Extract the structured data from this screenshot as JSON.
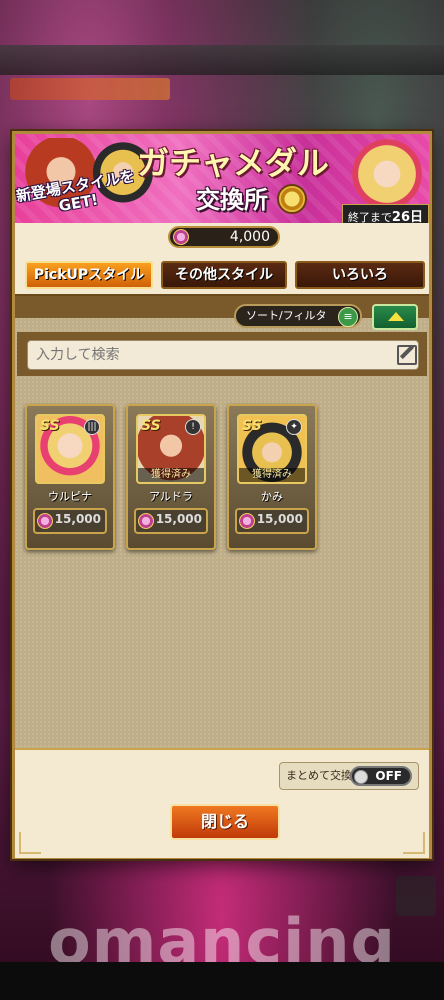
{
  "background": {
    "logo_text": "omancing"
  },
  "banner": {
    "title": "ガチャメダル",
    "subtitle": "交換所",
    "tag": "新登場スタイルをGET!",
    "end_label": "終了まで",
    "end_value": "26日"
  },
  "medal_balance": "4,000",
  "tabs": [
    {
      "label": "PickUPスタイル",
      "active": true
    },
    {
      "label": "その他スタイル",
      "active": false
    },
    {
      "label": "いろいろ",
      "active": false
    }
  ],
  "sort_label": "ソート/フィルタ",
  "search": {
    "placeholder": "入力して検索"
  },
  "items": [
    {
      "name": "ウルピナ",
      "price": "15,000",
      "owned_label": "",
      "rank": "SS"
    },
    {
      "name": "アルドラ",
      "price": "15,000",
      "owned_label": "獲得済み",
      "rank": "SS"
    },
    {
      "name": "かみ",
      "price": "15,000",
      "owned_label": "獲得済み",
      "rank": "SS"
    }
  ],
  "bulk_exchange": {
    "label": "まとめて交換",
    "state": "OFF"
  },
  "close_label": "閉じる"
}
